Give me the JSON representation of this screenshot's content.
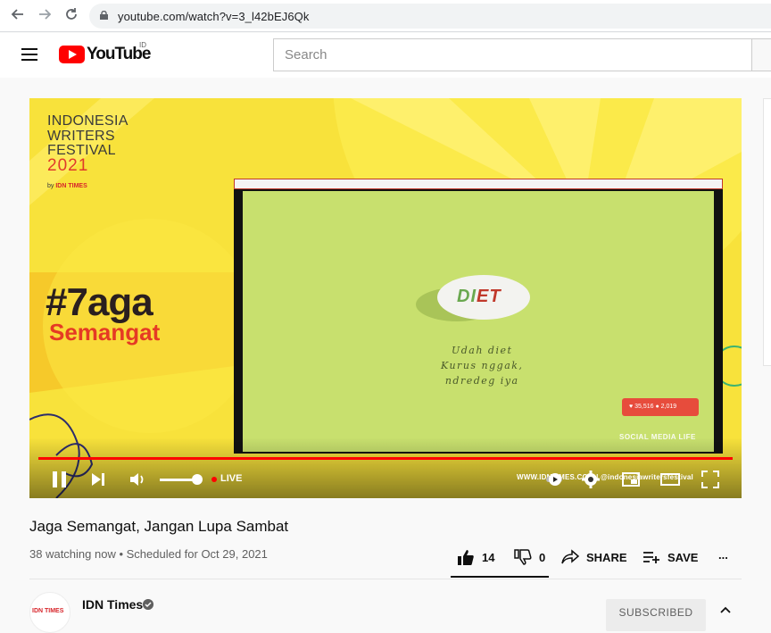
{
  "browser": {
    "url": "youtube.com/watch?v=3_l42bEJ6Qk"
  },
  "header": {
    "logo_text": "YouTube",
    "region": "ID",
    "search_placeholder": "Search"
  },
  "video": {
    "festival_line1": "INDONESIA",
    "festival_line2": "WRITERS",
    "festival_line3": "FESTIVAL",
    "festival_year": "2021",
    "by_prefix": "by",
    "by_brand": "IDN TIMES",
    "hashtag": "#7aga",
    "hashtag_sub": "Semangat",
    "inner_logo_left": "DI",
    "inner_logo_right": "ET",
    "handwritten_1": "Udah diet",
    "handwritten_2": "Kurus nggak,",
    "handwritten_3": "ndredeg iya",
    "likes_badge": "♥ 35,516  ● 2,019",
    "social_banner": "SOCIAL MEDIA LIFE",
    "overlay_url": "WWW.IDNTIMES.COM | @indonesiawritersfestival",
    "live_label": "LIVE",
    "volume_level": 0.85
  },
  "info": {
    "title": "Jaga Semangat, Jangan Lupa Sambat",
    "meta": "38 watching now • Scheduled for Oct 29, 2021",
    "like_count": "14",
    "dislike_count": "0",
    "share_label": "SHARE",
    "save_label": "SAVE",
    "more_label": "..."
  },
  "channel": {
    "name": "IDN Times",
    "avatar_text": "IDN TIMES",
    "subscribe_label": "SUBSCRIBED"
  },
  "colors": {
    "brand_red": "#ff0000",
    "player_yellow": "#f7e23a",
    "text_secondary": "#606060"
  }
}
